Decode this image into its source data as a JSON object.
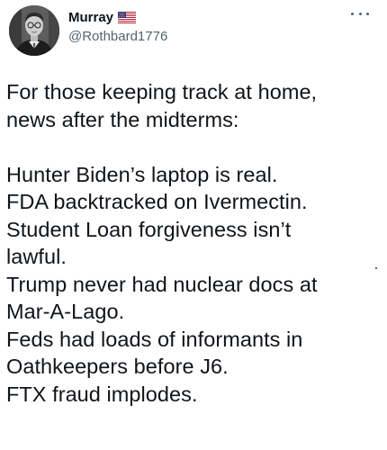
{
  "author": {
    "display_name": "Murray",
    "handle": "@Rothbard1776",
    "flag_icon": "us-flag-icon"
  },
  "menu": {
    "icon": "more-options-icon"
  },
  "tweet": {
    "lines": [
      "For those keeping track at home,",
      "news after the midterms:",
      "",
      "Hunter Biden’s laptop is real.",
      "FDA backtracked on Ivermectin.",
      "Student Loan forgiveness isn’t",
      "lawful.",
      "Trump never had nuclear docs at",
      "Mar-A-Lago.",
      "Feds had loads of informants in",
      "Oathkeepers before J6.",
      "FTX fraud implodes."
    ]
  },
  "colors": {
    "text": "#0f1419",
    "secondary": "#536471",
    "background": "#ffffff"
  }
}
